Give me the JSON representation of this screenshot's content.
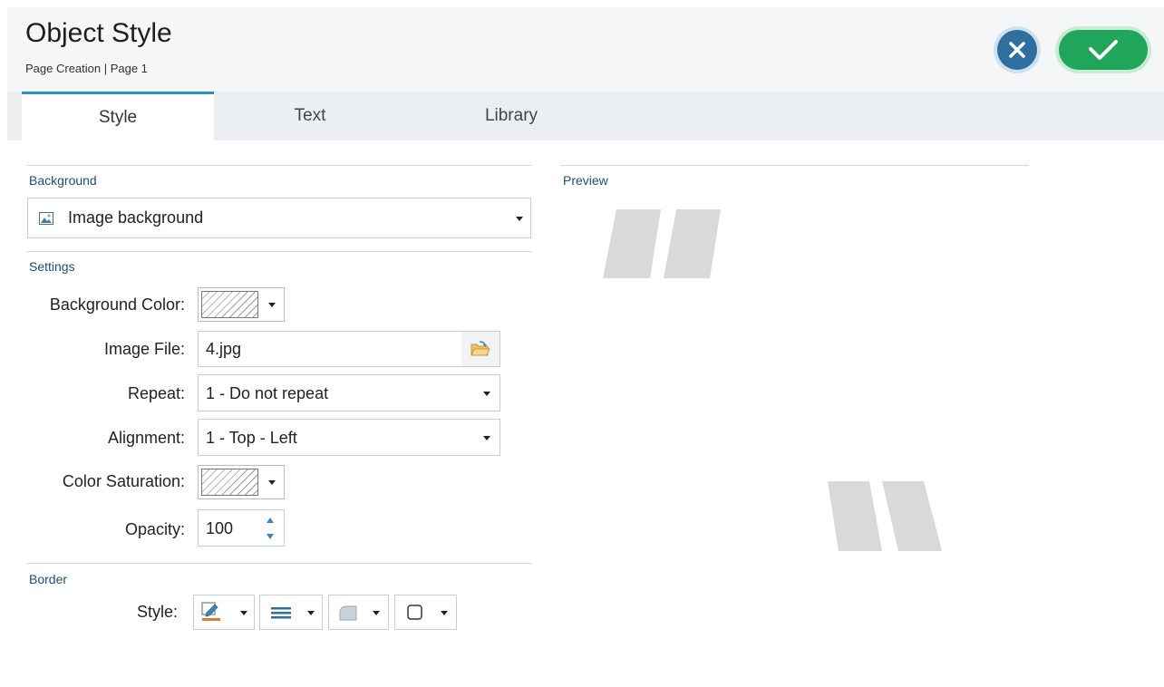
{
  "header": {
    "title": "Object Style",
    "subtitle": "Page Creation | Page 1",
    "cancel_icon": "close-icon",
    "ok_icon": "check-icon"
  },
  "tabs": [
    {
      "label": "Style",
      "active": true
    },
    {
      "label": "Text",
      "active": false
    },
    {
      "label": "Library",
      "active": false
    }
  ],
  "background": {
    "section_label": "Background",
    "type_value": "Image background",
    "type_icon": "image-icon"
  },
  "settings": {
    "section_label": "Settings",
    "background_color_label": "Background Color:",
    "image_file_label": "Image File:",
    "image_file_value": "4.jpg",
    "repeat_label": "Repeat:",
    "repeat_value": "1 - Do not repeat",
    "alignment_label": "Alignment:",
    "alignment_value": "1 - Top - Left",
    "color_saturation_label": "Color Saturation:",
    "opacity_label": "Opacity:",
    "opacity_value": "100"
  },
  "border": {
    "section_label": "Border",
    "style_label": "Style:"
  },
  "preview": {
    "section_label": "Preview"
  },
  "colors": {
    "accent": "#2a8fc4",
    "cancel": "#2f6f9f",
    "ok": "#1fa65a",
    "section_label": "#1f4e79"
  }
}
